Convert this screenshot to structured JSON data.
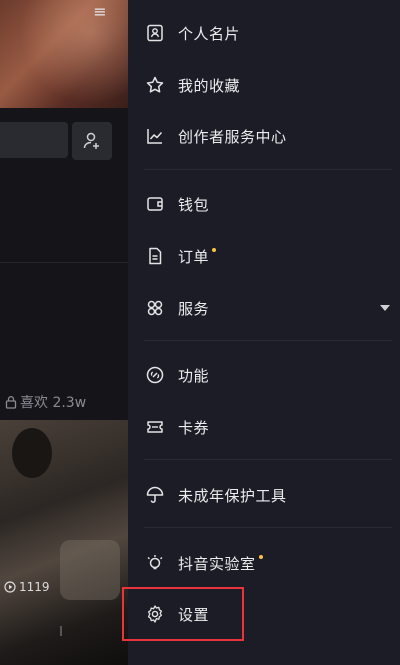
{
  "background": {
    "likes_label": "喜欢 2.3w",
    "play_count": "1119"
  },
  "drawer": {
    "items": [
      {
        "id": "card",
        "label": "个人名片",
        "icon": "id-card-icon"
      },
      {
        "id": "favorites",
        "label": "我的收藏",
        "icon": "star-icon"
      },
      {
        "id": "creator",
        "label": "创作者服务中心",
        "icon": "chart-icon"
      },
      {
        "id": "wallet",
        "label": "钱包",
        "icon": "wallet-icon"
      },
      {
        "id": "orders",
        "label": "订单",
        "icon": "document-icon",
        "badge": true
      },
      {
        "id": "services",
        "label": "服务",
        "icon": "grid-icon",
        "expandable": true
      },
      {
        "id": "features",
        "label": "功能",
        "icon": "link-icon"
      },
      {
        "id": "coupons",
        "label": "卡券",
        "icon": "ticket-icon"
      },
      {
        "id": "minor",
        "label": "未成年保护工具",
        "icon": "umbrella-icon"
      },
      {
        "id": "lab",
        "label": "抖音实验室",
        "icon": "bulb-icon",
        "badge": true
      },
      {
        "id": "settings",
        "label": "设置",
        "icon": "gear-icon",
        "highlighted": true
      }
    ]
  },
  "colors": {
    "drawer_bg": "#1c1c26",
    "badge": "#f5c542",
    "highlight": "#e8343a"
  }
}
